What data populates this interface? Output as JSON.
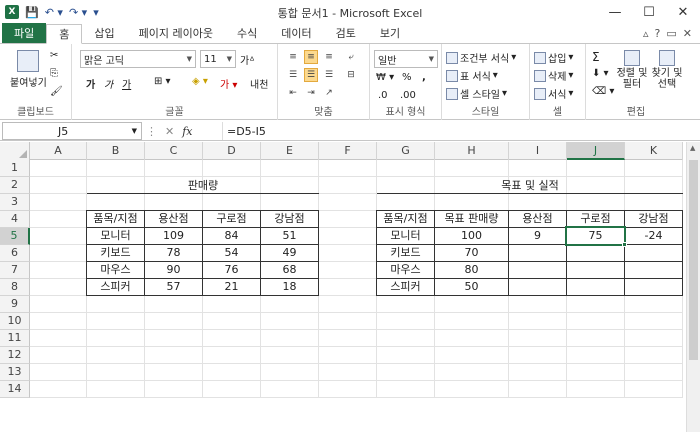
{
  "window": {
    "title": "통합 문서1 - Microsoft Excel",
    "app_icon": "X",
    "controls": [
      "—",
      "☐",
      "✕"
    ]
  },
  "tabs": [
    "파일",
    "홈",
    "삽입",
    "페이지 레이아웃",
    "수식",
    "데이터",
    "검토",
    "보기"
  ],
  "ribbon": {
    "clipboard": {
      "paste": "붙여넣기",
      "label": "클립보드"
    },
    "font": {
      "name": "맑은 고딕",
      "size": "11",
      "bold": "가",
      "italic": "가",
      "underline": "가",
      "label": "글꼴"
    },
    "align": {
      "label": "맞춤"
    },
    "number": {
      "format": "일반",
      "percent": "%",
      "comma": ",",
      "label": "표시 형식"
    },
    "style": {
      "conditional": "조건부 서식",
      "table": "표 서식",
      "cell": "셀 스타일",
      "label": "스타일"
    },
    "cells": {
      "insert": "삽입",
      "delete": "삭제",
      "format": "서식",
      "label": "셀"
    },
    "edit": {
      "sum": "Σ",
      "sort": "정렬 및 필터",
      "find": "찾기 및 선택",
      "label": "편집"
    }
  },
  "formula_bar": {
    "name_box": "J5",
    "formula": "=D5-I5",
    "fx": "fx"
  },
  "columns": [
    "A",
    "B",
    "C",
    "D",
    "E",
    "F",
    "G",
    "H",
    "I",
    "J",
    "K"
  ],
  "rows": [
    "1",
    "2",
    "3",
    "4",
    "5",
    "6",
    "7",
    "8",
    "9",
    "10",
    "11",
    "12",
    "13",
    "14"
  ],
  "sales_table": {
    "title": "판매량",
    "headers": [
      "품목/지점",
      "용산점",
      "구로점",
      "강남점"
    ],
    "rows": [
      [
        "모니터",
        "109",
        "84",
        "51"
      ],
      [
        "키보드",
        "78",
        "54",
        "49"
      ],
      [
        "마우스",
        "90",
        "76",
        "68"
      ],
      [
        "스피커",
        "57",
        "21",
        "18"
      ]
    ]
  },
  "target_table": {
    "title": "목표 및 실적",
    "headers": [
      "품목/지점",
      "목표 판매량",
      "용산점",
      "구로점",
      "강남점"
    ],
    "rows": [
      [
        "모니터",
        "100",
        "9",
        "75",
        "-24"
      ],
      [
        "키보드",
        "70",
        "",
        "",
        ""
      ],
      [
        "마우스",
        "80",
        "",
        "",
        ""
      ],
      [
        "스피커",
        "50",
        "",
        "",
        ""
      ]
    ]
  },
  "selected_cell": "J5"
}
